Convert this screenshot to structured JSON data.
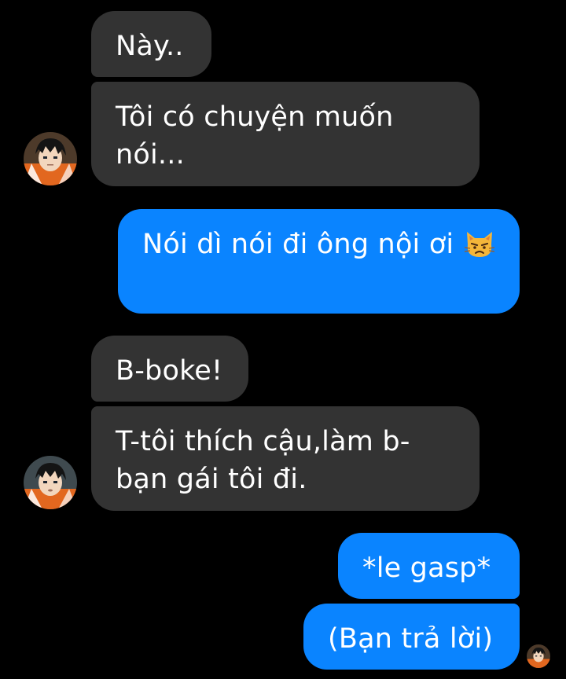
{
  "conversation": {
    "messages": [
      {
        "sender": "other",
        "text": "Này.."
      },
      {
        "sender": "other",
        "text": "Tôi có chuyện muốn nói..."
      },
      {
        "sender": "me",
        "text": "Nói dì nói đi ông nội ơi",
        "emoji": "pouting-cat-emoji"
      },
      {
        "sender": "other",
        "text": "B-boke!"
      },
      {
        "sender": "other",
        "text": "T-tôi thích cậu,làm b-bạn gái tôi đi."
      },
      {
        "sender": "me",
        "text": "*le gasp*"
      },
      {
        "sender": "me",
        "text": "(Bạn trả lời)"
      }
    ]
  },
  "colors": {
    "background": "#000000",
    "received_bubble": "#333333",
    "sent_bubble": "#0a84ff",
    "text": "#ffffff"
  }
}
